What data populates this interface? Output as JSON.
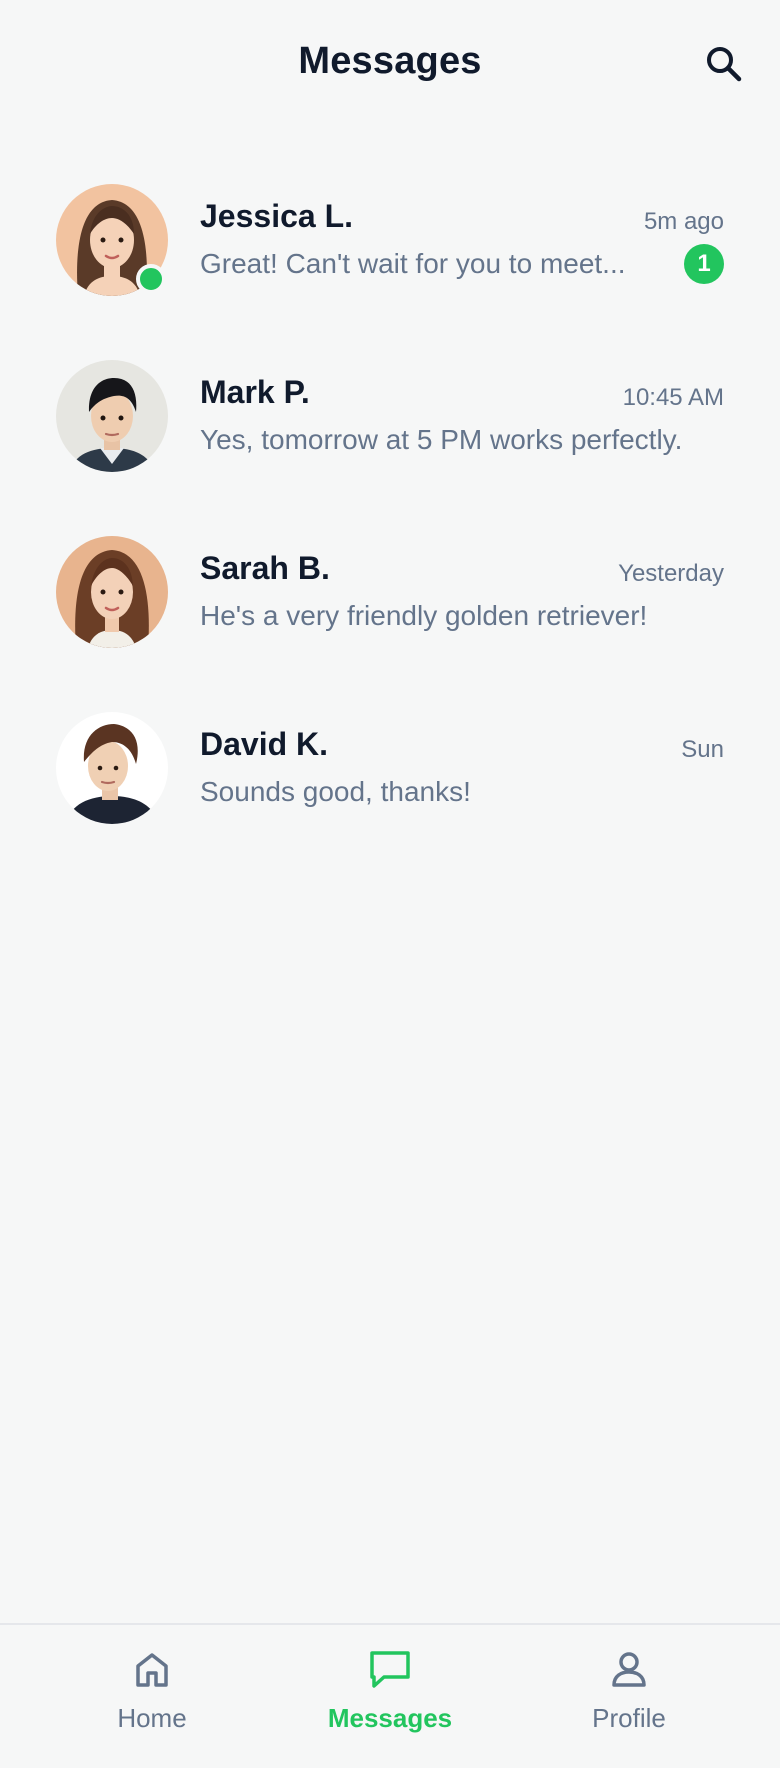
{
  "header": {
    "title": "Messages",
    "search_icon": "search-icon"
  },
  "conversations": [
    {
      "name": "Jessica L.",
      "time": "5m ago",
      "preview": "Great! Can't wait for you to meet...",
      "unread": "1",
      "online": true
    },
    {
      "name": "Mark P.",
      "time": "10:45 AM",
      "preview": "Yes, tomorrow at 5 PM works perfectly."
    },
    {
      "name": "Sarah B.",
      "time": "Yesterday",
      "preview": "He's a very friendly golden retriever!"
    },
    {
      "name": "David K.",
      "time": "Sun",
      "preview": "Sounds good, thanks!"
    }
  ],
  "nav": {
    "items": [
      {
        "label": "Home",
        "icon": "home-icon"
      },
      {
        "label": "Messages",
        "icon": "chat-icon",
        "active": true
      },
      {
        "label": "Profile",
        "icon": "user-icon"
      }
    ]
  },
  "colors": {
    "accent": "#22c55e",
    "text_primary": "#101a2c",
    "text_secondary": "#64748b",
    "background": "#f6f7f7"
  }
}
